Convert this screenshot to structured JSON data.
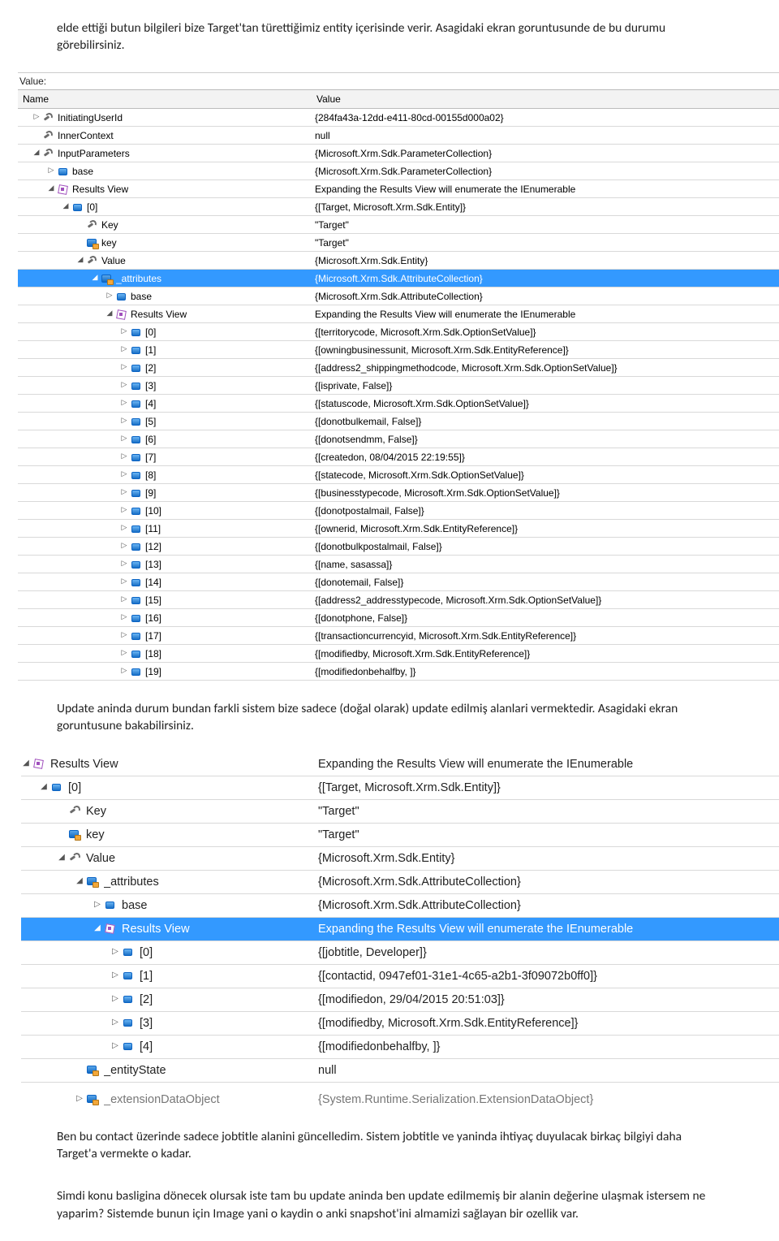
{
  "paragraphs": {
    "p1": "elde ettiği butun bilgileri bize Target'tan türettiğimiz entity içerisinde verir. Asagidaki ekran goruntusunde de bu durumu görebilirsiniz.",
    "p2": "Update aninda durum bundan farkli sistem bize sadece (doğal olarak) update edilmiş alanlari vermektedir. Asagidaki ekran goruntusune bakabilirsiniz.",
    "p3": "Ben bu contact üzerinde sadece jobtitle alanini güncelledim. Sistem jobtitle ve yaninda ihtiyaç duyulacak birkaç bilgiyi daha Target'a vermekte o kadar.",
    "p4": "Simdi konu basligina dönecek olursak iste tam bu update aninda ben update edilmemiş bir alanin değerine ulaşmak istersem ne yaparim? Sistemde bunun için Image yani o kaydin o anki snapshot'ini almamizi sağlayan bir ozellik var."
  },
  "debug1": {
    "value_label": "Value:",
    "headers": {
      "name": "Name",
      "value": "Value"
    },
    "rows": [
      {
        "depth": 1,
        "exp": "r",
        "ico": "wrench",
        "name": "InitiatingUserId",
        "value": "{284fa43a-12dd-e411-80cd-00155d000a02}"
      },
      {
        "depth": 1,
        "exp": "e",
        "ico": "wrench",
        "name": "InnerContext",
        "value": "null"
      },
      {
        "depth": 1,
        "exp": "d",
        "ico": "wrench",
        "name": "InputParameters",
        "value": "{Microsoft.Xrm.Sdk.ParameterCollection}"
      },
      {
        "depth": 2,
        "exp": "r",
        "ico": "field",
        "name": "base",
        "value": "{Microsoft.Xrm.Sdk.ParameterCollection}"
      },
      {
        "depth": 2,
        "exp": "d",
        "ico": "rview",
        "name": "Results View",
        "value": "Expanding the Results View will enumerate the IEnumerable"
      },
      {
        "depth": 3,
        "exp": "d",
        "ico": "field",
        "name": "[0]",
        "value": "{[Target, Microsoft.Xrm.Sdk.Entity]}"
      },
      {
        "depth": 4,
        "exp": "e",
        "ico": "wrench",
        "name": "Key",
        "value": "\"Target\""
      },
      {
        "depth": 4,
        "exp": "e",
        "ico": "prop",
        "name": "key",
        "value": "\"Target\""
      },
      {
        "depth": 4,
        "exp": "d",
        "ico": "wrench",
        "name": "Value",
        "value": "{Microsoft.Xrm.Sdk.Entity}"
      },
      {
        "depth": 5,
        "exp": "d",
        "ico": "prop",
        "name": "_attributes",
        "value": "{Microsoft.Xrm.Sdk.AttributeCollection}",
        "selected": true
      },
      {
        "depth": 6,
        "exp": "r",
        "ico": "field",
        "name": "base",
        "value": "{Microsoft.Xrm.Sdk.AttributeCollection}"
      },
      {
        "depth": 6,
        "exp": "d",
        "ico": "rview",
        "name": "Results View",
        "value": "Expanding the Results View will enumerate the IEnumerable"
      },
      {
        "depth": 7,
        "exp": "r",
        "ico": "field",
        "name": "[0]",
        "value": "{[territorycode, Microsoft.Xrm.Sdk.OptionSetValue]}"
      },
      {
        "depth": 7,
        "exp": "r",
        "ico": "field",
        "name": "[1]",
        "value": "{[owningbusinessunit, Microsoft.Xrm.Sdk.EntityReference]}"
      },
      {
        "depth": 7,
        "exp": "r",
        "ico": "field",
        "name": "[2]",
        "value": "{[address2_shippingmethodcode, Microsoft.Xrm.Sdk.OptionSetValue]}"
      },
      {
        "depth": 7,
        "exp": "r",
        "ico": "field",
        "name": "[3]",
        "value": "{[isprivate, False]}"
      },
      {
        "depth": 7,
        "exp": "r",
        "ico": "field",
        "name": "[4]",
        "value": "{[statuscode, Microsoft.Xrm.Sdk.OptionSetValue]}"
      },
      {
        "depth": 7,
        "exp": "r",
        "ico": "field",
        "name": "[5]",
        "value": "{[donotbulkemail, False]}"
      },
      {
        "depth": 7,
        "exp": "r",
        "ico": "field",
        "name": "[6]",
        "value": "{[donotsendmm, False]}"
      },
      {
        "depth": 7,
        "exp": "r",
        "ico": "field",
        "name": "[7]",
        "value": "{[createdon, 08/04/2015 22:19:55]}"
      },
      {
        "depth": 7,
        "exp": "r",
        "ico": "field",
        "name": "[8]",
        "value": "{[statecode, Microsoft.Xrm.Sdk.OptionSetValue]}"
      },
      {
        "depth": 7,
        "exp": "r",
        "ico": "field",
        "name": "[9]",
        "value": "{[businesstypecode, Microsoft.Xrm.Sdk.OptionSetValue]}"
      },
      {
        "depth": 7,
        "exp": "r",
        "ico": "field",
        "name": "[10]",
        "value": "{[donotpostalmail, False]}"
      },
      {
        "depth": 7,
        "exp": "r",
        "ico": "field",
        "name": "[11]",
        "value": "{[ownerid, Microsoft.Xrm.Sdk.EntityReference]}"
      },
      {
        "depth": 7,
        "exp": "r",
        "ico": "field",
        "name": "[12]",
        "value": "{[donotbulkpostalmail, False]}"
      },
      {
        "depth": 7,
        "exp": "r",
        "ico": "field",
        "name": "[13]",
        "value": "{[name, sasassa]}"
      },
      {
        "depth": 7,
        "exp": "r",
        "ico": "field",
        "name": "[14]",
        "value": "{[donotemail, False]}"
      },
      {
        "depth": 7,
        "exp": "r",
        "ico": "field",
        "name": "[15]",
        "value": "{[address2_addresstypecode, Microsoft.Xrm.Sdk.OptionSetValue]}"
      },
      {
        "depth": 7,
        "exp": "r",
        "ico": "field",
        "name": "[16]",
        "value": "{[donotphone, False]}"
      },
      {
        "depth": 7,
        "exp": "r",
        "ico": "field",
        "name": "[17]",
        "value": "{[transactioncurrencyid, Microsoft.Xrm.Sdk.EntityReference]}"
      },
      {
        "depth": 7,
        "exp": "r",
        "ico": "field",
        "name": "[18]",
        "value": "{[modifiedby, Microsoft.Xrm.Sdk.EntityReference]}"
      },
      {
        "depth": 7,
        "exp": "r",
        "ico": "field",
        "name": "[19]",
        "value": "{[modifiedonbehalfby, ]}"
      }
    ]
  },
  "debug2": {
    "rows": [
      {
        "depth": 0,
        "exp": "d",
        "ico": "rview",
        "name": "Results View",
        "value": "Expanding the Results View will enumerate the IEnumerable"
      },
      {
        "depth": 1,
        "exp": "d",
        "ico": "field",
        "name": "[0]",
        "value": "{[Target, Microsoft.Xrm.Sdk.Entity]}"
      },
      {
        "depth": 2,
        "exp": "e",
        "ico": "wrench",
        "name": "Key",
        "value": "\"Target\""
      },
      {
        "depth": 2,
        "exp": "e",
        "ico": "prop",
        "name": "key",
        "value": "\"Target\""
      },
      {
        "depth": 2,
        "exp": "d",
        "ico": "wrench",
        "name": "Value",
        "value": "{Microsoft.Xrm.Sdk.Entity}"
      },
      {
        "depth": 3,
        "exp": "d",
        "ico": "prop",
        "name": "_attributes",
        "value": "{Microsoft.Xrm.Sdk.AttributeCollection}"
      },
      {
        "depth": 4,
        "exp": "r",
        "ico": "field",
        "name": "base",
        "value": "{Microsoft.Xrm.Sdk.AttributeCollection}"
      },
      {
        "depth": 4,
        "exp": "d",
        "ico": "rview",
        "name": "Results View",
        "value": "Expanding the Results View will enumerate the IEnumerable",
        "selected": true
      },
      {
        "depth": 5,
        "exp": "r",
        "ico": "field",
        "name": "[0]",
        "value": "{[jobtitle, Developer]}"
      },
      {
        "depth": 5,
        "exp": "r",
        "ico": "field",
        "name": "[1]",
        "value": "{[contactid, 0947ef01-31e1-4c65-a2b1-3f09072b0ff0]}"
      },
      {
        "depth": 5,
        "exp": "r",
        "ico": "field",
        "name": "[2]",
        "value": "{[modifiedon, 29/04/2015 20:51:03]}"
      },
      {
        "depth": 5,
        "exp": "r",
        "ico": "field",
        "name": "[3]",
        "value": "{[modifiedby, Microsoft.Xrm.Sdk.EntityReference]}"
      },
      {
        "depth": 5,
        "exp": "r",
        "ico": "field",
        "name": "[4]",
        "value": "{[modifiedonbehalfby, ]}"
      },
      {
        "depth": 3,
        "exp": "e",
        "ico": "prop",
        "name": "_entityState",
        "value": "null"
      },
      {
        "depth": 3,
        "exp": "r",
        "ico": "prop",
        "name": "_extensionDataObject",
        "value": "{System.Runtime.Serialization.ExtensionDataObject}",
        "cutoff": true
      }
    ]
  }
}
